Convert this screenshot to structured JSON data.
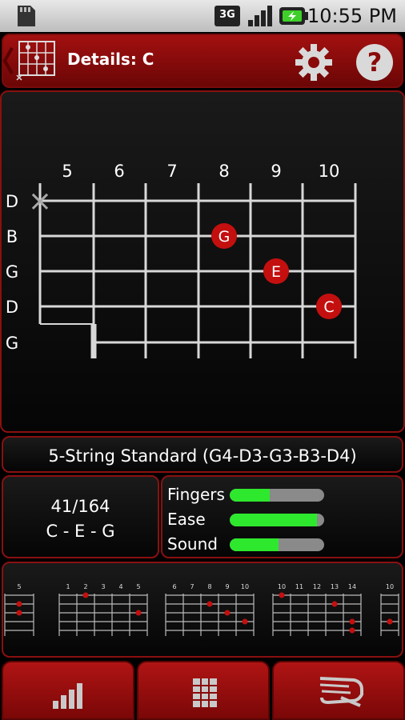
{
  "status_bar": {
    "time": "10:55 PM",
    "network": "3G"
  },
  "header": {
    "title": "Details: C"
  },
  "fretboard": {
    "fret_numbers": [
      "5",
      "6",
      "7",
      "8",
      "9",
      "10"
    ],
    "string_labels": [
      "D",
      "B",
      "G",
      "D",
      "G"
    ],
    "muted_marker": "×",
    "notes": [
      {
        "label": "G",
        "string": 1,
        "fret": 8
      },
      {
        "label": "E",
        "string": 2,
        "fret": 9
      },
      {
        "label": "C",
        "string": 3,
        "fret": 10
      }
    ]
  },
  "tuning": {
    "label": "5-String Standard (G4-D3-G3-B3-D4)"
  },
  "stats": {
    "position": "41/164",
    "notes": "C - E - G"
  },
  "ratings": {
    "items": [
      {
        "label": "Fingers",
        "value": 0.42
      },
      {
        "label": "Ease",
        "value": 0.92
      },
      {
        "label": "Sound",
        "value": 0.52
      }
    ]
  },
  "thumbnails": {
    "items": [
      {
        "frets": [
          "5"
        ]
      },
      {
        "frets": [
          "1",
          "2",
          "3",
          "4",
          "5"
        ]
      },
      {
        "frets": [
          "6",
          "7",
          "8",
          "9",
          "10"
        ]
      },
      {
        "frets": [
          "10",
          "11",
          "12",
          "13",
          "14"
        ]
      },
      {
        "frets": [
          "10"
        ]
      }
    ]
  },
  "bottom_nav": {
    "items": [
      "chords-icon",
      "fretboard-icon",
      "capo-icon"
    ]
  },
  "colors": {
    "accent": "#a81010",
    "note": "#c40f0f",
    "bar_fill": "#2ee82e"
  }
}
